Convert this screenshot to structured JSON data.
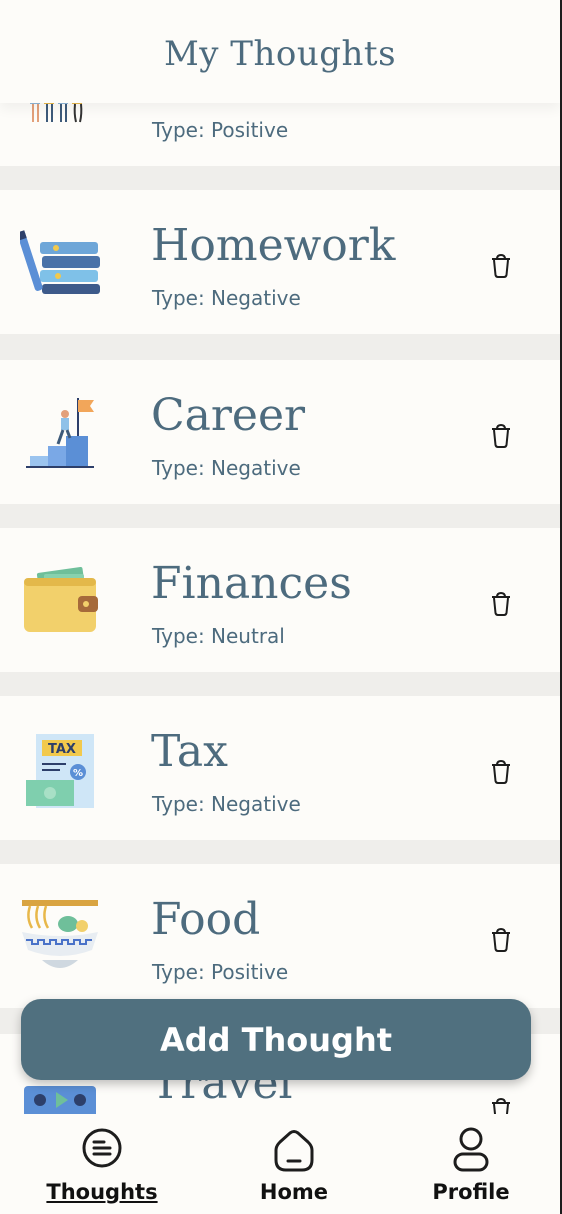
{
  "header": {
    "title": "My Thoughts"
  },
  "thoughts": [
    {
      "title": "",
      "type_text": "Type: Positive",
      "icon": "people-icon"
    },
    {
      "title": "Homework",
      "type_text": "Type: Negative",
      "icon": "books-pencil-icon"
    },
    {
      "title": "Career",
      "type_text": "Type: Negative",
      "icon": "career-stairs-flag-icon"
    },
    {
      "title": "Finances",
      "type_text": "Type: Neutral",
      "icon": "wallet-icon"
    },
    {
      "title": "Tax",
      "type_text": "Type: Negative",
      "icon": "tax-document-icon"
    },
    {
      "title": "Food",
      "type_text": "Type: Positive",
      "icon": "noodle-bowl-icon"
    },
    {
      "title": "Travel",
      "type_text": "",
      "icon": "calendar-travel-icon"
    }
  ],
  "add_button": {
    "label": "Add Thought"
  },
  "tabs": [
    {
      "label": "Thoughts",
      "icon": "thoughts-list-icon",
      "active": true
    },
    {
      "label": "Home",
      "icon": "home-icon",
      "active": false
    },
    {
      "label": "Profile",
      "icon": "profile-icon",
      "active": false
    }
  ],
  "colors": {
    "primary": "#4d6b7e",
    "button": "#50707f",
    "background": "#fdfcf9",
    "separator": "#efeeeb"
  }
}
